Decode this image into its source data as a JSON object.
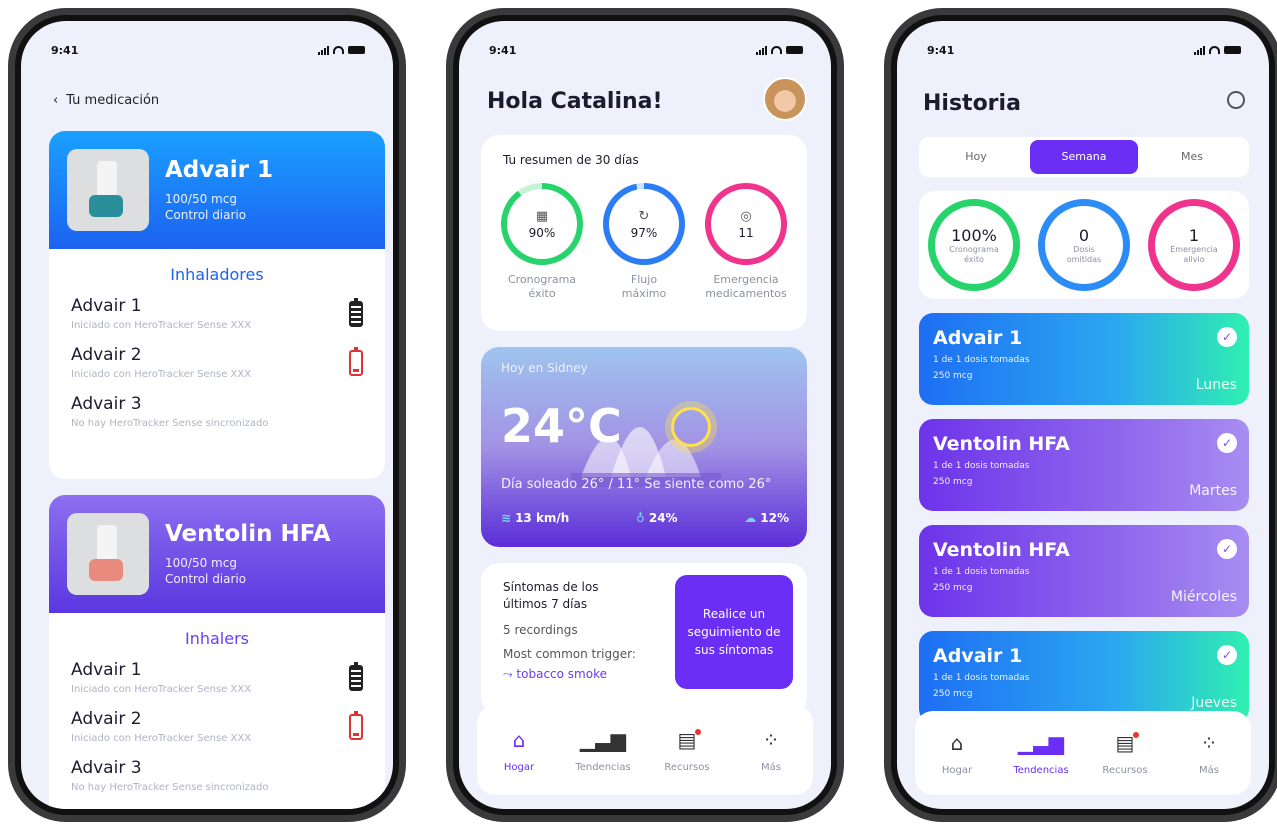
{
  "status_time": "9:41",
  "medication": {
    "back_label": "Tu medicación",
    "cards": [
      {
        "title": "Advair 1",
        "dose": "100/50 mcg",
        "schedule": "Control diario",
        "section_title": "Inhaladores",
        "color": "#1d62f0",
        "rows": [
          {
            "name": "Advair 1",
            "desc": "Iniciado con HeroTracker Sense XXX",
            "battery": "full"
          },
          {
            "name": "Advair 2",
            "desc": "Iniciado con HeroTracker Sense XXX",
            "battery": "low"
          },
          {
            "name": "Advair 3",
            "desc": "No hay HeroTracker Sense sincronizado",
            "battery": "none"
          }
        ]
      },
      {
        "title": "Ventolin HFA",
        "dose": "100/50 mcg",
        "schedule": "Control diario",
        "section_title": "Inhalers",
        "color": "#5a37e0",
        "rows": [
          {
            "name": "Advair 1",
            "desc": "Iniciado con HeroTracker Sense XXX",
            "battery": "full"
          },
          {
            "name": "Advair 2",
            "desc": "Iniciado con HeroTracker Sense XXX",
            "battery": "low"
          },
          {
            "name": "Advair 3",
            "desc": "No hay HeroTracker Sense sincronizado",
            "battery": "none"
          }
        ]
      }
    ]
  },
  "home": {
    "greeting": "Hola Catalina!",
    "summary_title": "Tu resumen de 30 días",
    "rings": [
      {
        "value": "90%",
        "label_1": "Cronograma",
        "label_2": "éxito",
        "icon": "calendar-icon",
        "color": "#27d36b",
        "fill": 0.9
      },
      {
        "value": "97%",
        "label_1": "Flujo",
        "label_2": "máximo",
        "icon": "refresh-icon",
        "color": "#2b7cf5",
        "fill": 0.97
      },
      {
        "value": "11",
        "label_1": "Emergencia",
        "label_2": "medicamentos",
        "icon": "camera-icon",
        "color": "#f0338c",
        "fill": 1.0
      }
    ],
    "weather": {
      "location": "Hoy en Sidney",
      "temperature": "24°C",
      "description": "Día soleado 26° / 11°  Se siente como 26°",
      "wind": "13 km/h",
      "humidity": "24%",
      "rain": "12%"
    },
    "symptoms": {
      "title": "Síntomas de los últimos 7 días",
      "recordings": "5 recordings",
      "trigger_label": "Most common trigger:",
      "trigger_value": "tobacco smoke",
      "button": "Realice un seguimiento de sus síntomas"
    },
    "nav": [
      {
        "label": "Hogar",
        "icon": "home-icon",
        "active": true
      },
      {
        "label": "Tendencias",
        "icon": "trends-icon",
        "active": false
      },
      {
        "label": "Recursos",
        "icon": "resources-icon",
        "active": false
      },
      {
        "label": "Más",
        "icon": "more-icon",
        "active": false
      }
    ]
  },
  "history": {
    "title": "Historia",
    "segments": [
      "Hoy",
      "Semana",
      "Mes"
    ],
    "selected_segment": "Semana",
    "rings": [
      {
        "value": "100%",
        "label": "Cronograma éxito",
        "color": "#27d36b"
      },
      {
        "value": "0",
        "label": "Dosis omitidas",
        "color": "#2b7cf5"
      },
      {
        "value": "1",
        "label": "Emergencia alivio",
        "color": "#f0338c"
      }
    ],
    "entries": [
      {
        "name": "Advair 1",
        "doses": "1 de 1 dosis tomadas",
        "dose": "250 mcg",
        "day": "Lunes",
        "style": "blue"
      },
      {
        "name": "Ventolin HFA",
        "doses": "1 de 1 dosis tomadas",
        "dose": "250 mcg",
        "day": "Martes",
        "style": "purple"
      },
      {
        "name": "Ventolin HFA",
        "doses": "1 de 1 dosis tomadas",
        "dose": "250 mcg",
        "day": "Miércoles",
        "style": "purple"
      },
      {
        "name": "Advair 1",
        "doses": "1 de 1 dosis tomadas",
        "dose": "250 mcg",
        "day": "Jueves",
        "style": "blue"
      }
    ],
    "nav": [
      {
        "label": "Hogar",
        "icon": "home-icon",
        "active": false
      },
      {
        "label": "Tendencias",
        "icon": "trends-icon",
        "active": true
      },
      {
        "label": "Recursos",
        "icon": "resources-icon",
        "active": false
      },
      {
        "label": "Más",
        "icon": "more-icon",
        "active": false
      }
    ]
  }
}
